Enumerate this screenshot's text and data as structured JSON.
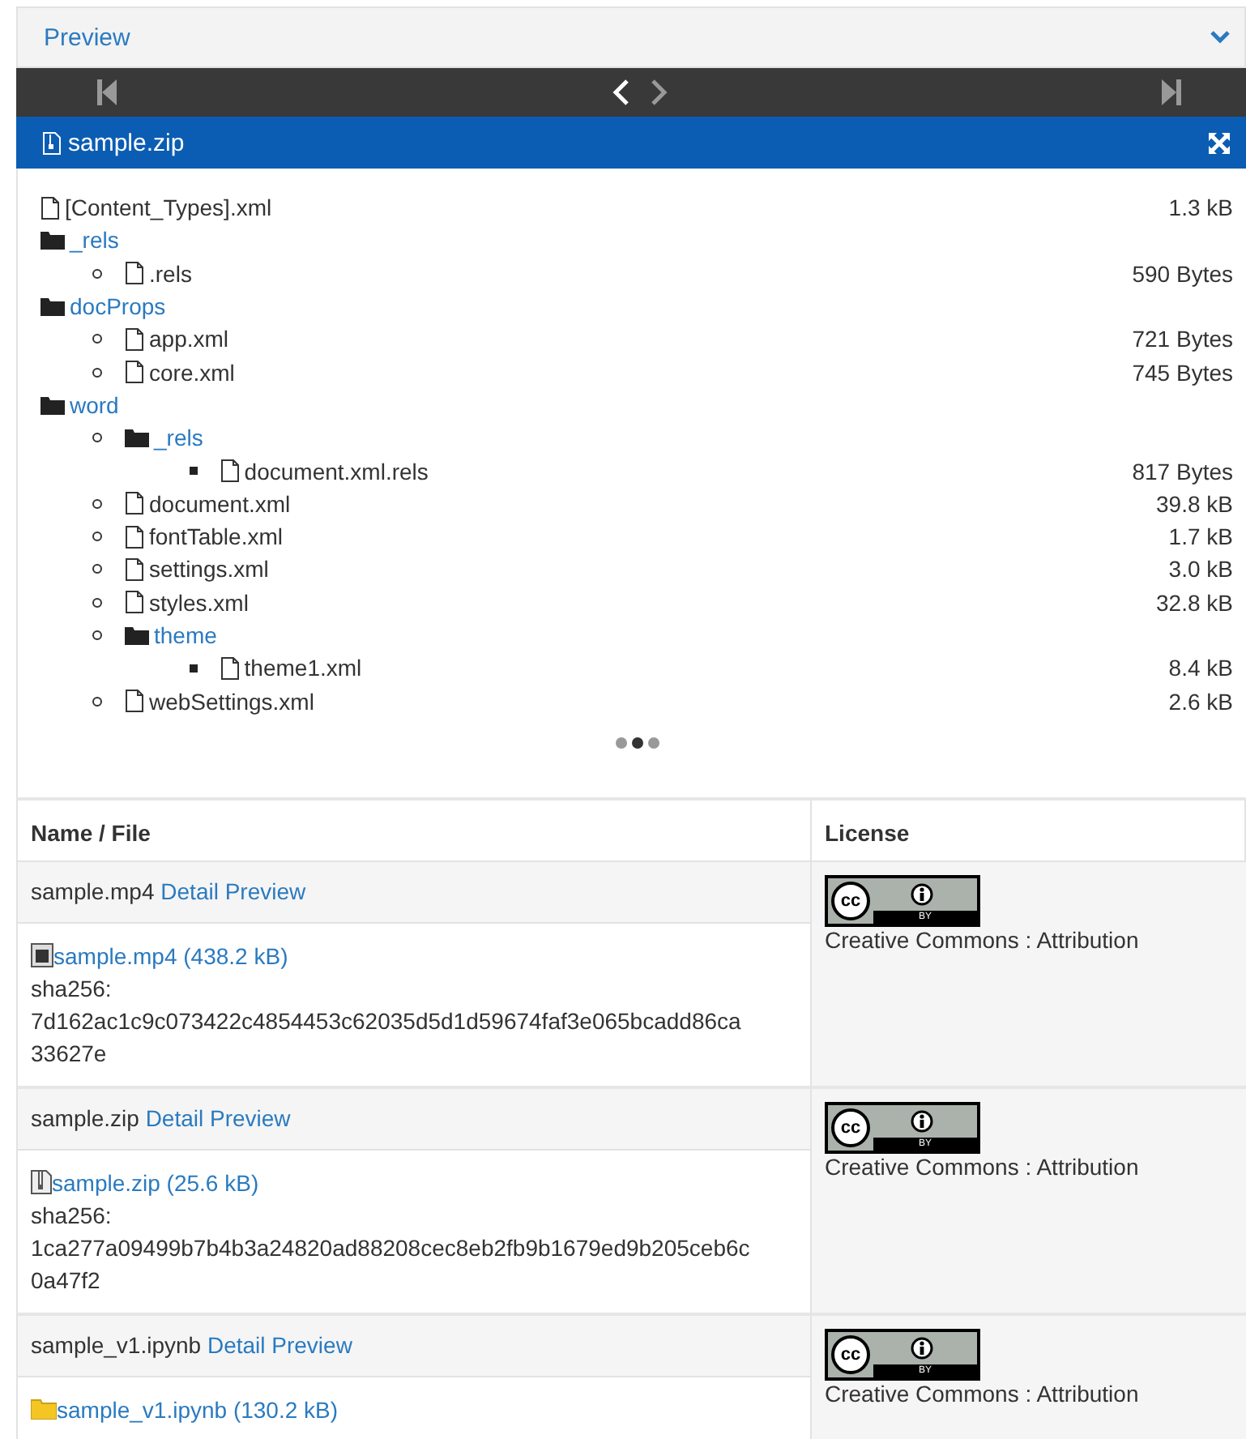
{
  "panel": {
    "title": "Preview",
    "expanded": true
  },
  "viewer": {
    "file_name": "sample.zip"
  },
  "tree": [
    {
      "kind": "file",
      "name": "[Content_Types].xml",
      "size": "1.3 kB"
    },
    {
      "kind": "folder",
      "name": "_rels",
      "children": [
        {
          "kind": "file",
          "name": ".rels",
          "size": "590 Bytes"
        }
      ]
    },
    {
      "kind": "folder",
      "name": "docProps",
      "children": [
        {
          "kind": "file",
          "name": "app.xml",
          "size": "721 Bytes"
        },
        {
          "kind": "file",
          "name": "core.xml",
          "size": "745 Bytes"
        }
      ]
    },
    {
      "kind": "folder",
      "name": "word",
      "children": [
        {
          "kind": "folder",
          "name": "_rels",
          "children": [
            {
              "kind": "file",
              "name": "document.xml.rels",
              "size": "817 Bytes"
            }
          ]
        },
        {
          "kind": "file",
          "name": "document.xml",
          "size": "39.8 kB"
        },
        {
          "kind": "file",
          "name": "fontTable.xml",
          "size": "1.7 kB"
        },
        {
          "kind": "file",
          "name": "settings.xml",
          "size": "3.0 kB"
        },
        {
          "kind": "file",
          "name": "styles.xml",
          "size": "32.8 kB"
        },
        {
          "kind": "folder",
          "name": "theme",
          "children": [
            {
              "kind": "file",
              "name": "theme1.xml",
              "size": "8.4 kB"
            }
          ]
        },
        {
          "kind": "file",
          "name": "webSettings.xml",
          "size": "2.6 kB"
        }
      ]
    }
  ],
  "carousel_dots": [
    {
      "selected": false
    },
    {
      "selected": true
    },
    {
      "selected": false
    }
  ],
  "table": {
    "columns": [
      "Name / File",
      "License"
    ],
    "rows": [
      {
        "name": "sample.mp4",
        "links": [
          "Detail",
          "Preview"
        ],
        "kind": "video",
        "file_link": "sample.mp4 (438.2 kB)",
        "hash_label": "sha256:",
        "hash": "7d162ac1c9c073422c4854453c62035d5d1d59674faf3e065bcadd86ca33627e",
        "license": {
          "cc": "cc",
          "by": "BY",
          "name": "Creative Commons : Attribution"
        }
      },
      {
        "name": "sample.zip",
        "links": [
          "Detail",
          "Preview"
        ],
        "kind": "zip",
        "file_link": "sample.zip (25.6 kB)",
        "hash_label": "sha256:",
        "hash": "1ca277a09499b7b4b3a24820ad88208cec8eb2fb9b1679ed9b205ceb6c0a47f2",
        "license": {
          "cc": "cc",
          "by": "BY",
          "name": "Creative Commons : Attribution"
        }
      },
      {
        "name": "sample_v1.ipynb",
        "links": [
          "Detail",
          "Preview"
        ],
        "kind": "folder",
        "file_link": "sample_v1.ipynb (130.2 kB)",
        "license": {
          "cc": "cc",
          "by": "BY",
          "name": "Creative Commons : Attribution"
        }
      }
    ]
  }
}
